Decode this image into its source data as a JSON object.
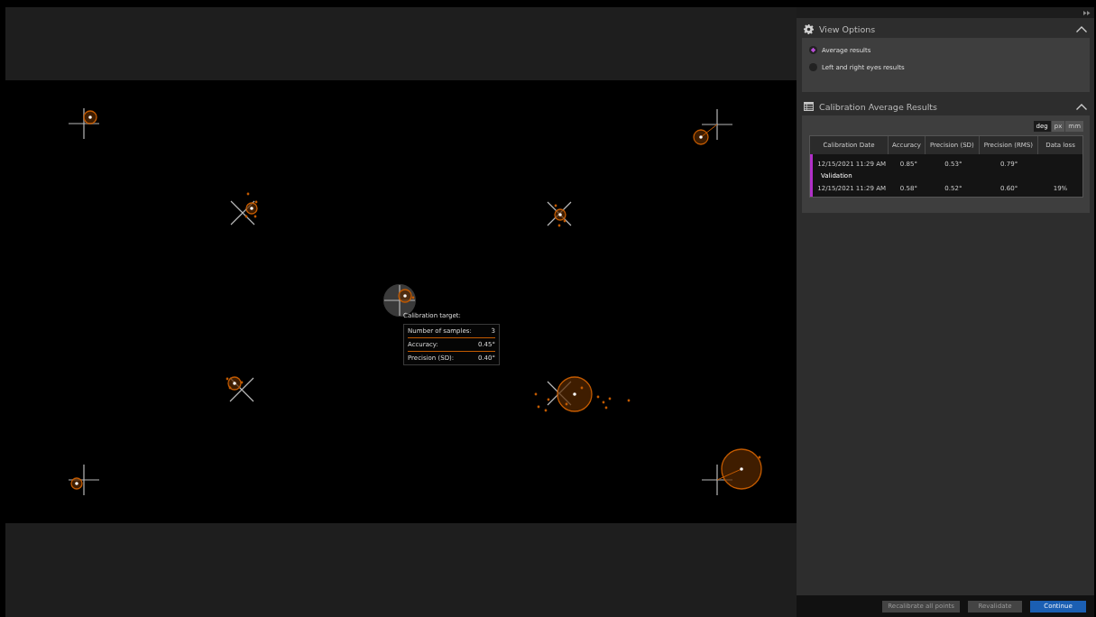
{
  "view_options": {
    "title": "View Options",
    "expanded": true,
    "options": [
      {
        "label": "Average results",
        "selected": true
      },
      {
        "label": "Left and right eyes results",
        "selected": false
      }
    ]
  },
  "results": {
    "title": "Calibration Average Results",
    "expanded": true,
    "units": [
      {
        "label": "deg",
        "selected": true
      },
      {
        "label": "px",
        "selected": false
      },
      {
        "label": "mm",
        "selected": false
      }
    ],
    "columns": [
      "Calibration Date",
      "Accuracy",
      "Precision (SD)",
      "Precision (RMS)",
      "Data loss"
    ],
    "rows": [
      {
        "kind": "data",
        "cells": [
          "12/15/2021 11:29 AM",
          "0.85°",
          "0.53°",
          "0.79°",
          ""
        ]
      },
      {
        "kind": "section",
        "label": "Validation"
      },
      {
        "kind": "data",
        "cells": [
          "12/15/2021 11:29 AM",
          "0.58°",
          "0.52°",
          "0.60°",
          "19%"
        ]
      }
    ]
  },
  "tooltip": {
    "title": "Calibration target:",
    "rows": [
      {
        "label": "Number of samples:",
        "value": "3"
      },
      {
        "label": "Accuracy:",
        "value": "0.45°"
      },
      {
        "label": "Precision (SD):",
        "value": "0.40°"
      }
    ]
  },
  "buttons": [
    {
      "label": "Recalibrate all points",
      "primary": false
    },
    {
      "label": "Revalidate",
      "primary": false
    },
    {
      "label": "Continue",
      "primary": true
    }
  ]
}
